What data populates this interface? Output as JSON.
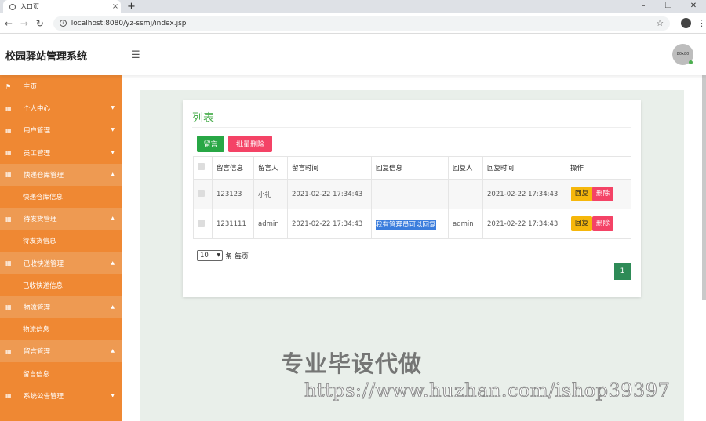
{
  "browser": {
    "tab_title": "入口页",
    "tab_close": "×",
    "new_tab": "+",
    "minimize": "–",
    "restore": "❐",
    "close": "✕",
    "url": "localhost:8080/yz-ssmj/index.jsp"
  },
  "header": {
    "brand": "校园驿站管理系统",
    "avatar_text": "80x80"
  },
  "sidebar": {
    "items": [
      {
        "label": "主页",
        "type": "parent",
        "open": false,
        "chevron": false
      },
      {
        "label": "个人中心",
        "type": "parent",
        "open": false,
        "chevron": true
      },
      {
        "label": "用户管理",
        "type": "parent",
        "open": false,
        "chevron": true
      },
      {
        "label": "员工管理",
        "type": "parent",
        "open": false,
        "chevron": true
      },
      {
        "label": "快递仓库管理",
        "type": "parent",
        "open": true,
        "chevron": true
      },
      {
        "label": "快递仓库信息",
        "type": "child"
      },
      {
        "label": "待发货管理",
        "type": "parent",
        "open": true,
        "chevron": true
      },
      {
        "label": "待发货信息",
        "type": "child"
      },
      {
        "label": "已收快递管理",
        "type": "parent",
        "open": true,
        "chevron": true
      },
      {
        "label": "已收快递信息",
        "type": "child"
      },
      {
        "label": "物流管理",
        "type": "parent",
        "open": true,
        "chevron": true
      },
      {
        "label": "物流信息",
        "type": "child"
      },
      {
        "label": "留言管理",
        "type": "parent",
        "open": true,
        "chevron": true
      },
      {
        "label": "留言信息",
        "type": "child"
      },
      {
        "label": "系统公告管理",
        "type": "parent",
        "open": false,
        "chevron": true
      }
    ]
  },
  "main": {
    "title": "列表",
    "add_label": "留言",
    "bulk_delete_label": "批量删除",
    "columns": [
      "留言信息",
      "留言人",
      "留言时间",
      "回复信息",
      "回复人",
      "回复时间",
      "操作"
    ],
    "rows": [
      {
        "message": "123123",
        "author": "小礼",
        "time": "2021-02-22 17:34:43",
        "reply": "",
        "replier": "",
        "reply_time": "2021-02-22 17:34:43"
      },
      {
        "message": "1231111",
        "author": "admin",
        "time": "2021-02-22 17:34:43",
        "reply": "我有管理员可以回复",
        "replier": "admin",
        "reply_time": "2021-02-22 17:34:43"
      }
    ],
    "reply_label": "回复",
    "delete_label": "删除",
    "page_size": "10",
    "page_size_suffix": "条 每页",
    "current_page": "1"
  },
  "watermark": {
    "line1": "专业毕设代做",
    "line2": "https://www.huzhan.com/ishop39397"
  },
  "colors": {
    "sidebar": "#ef8833",
    "accent_green": "#28a745",
    "danger": "#f44366",
    "warning": "#f6b70b"
  }
}
